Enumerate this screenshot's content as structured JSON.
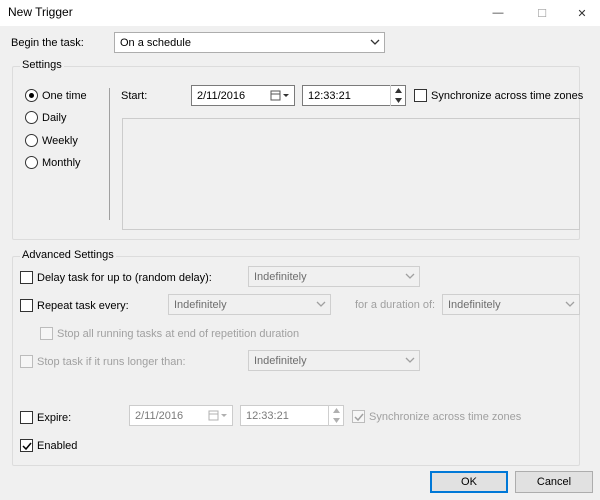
{
  "window": {
    "title": "New Trigger",
    "minimize_glyph": "—",
    "maximize_glyph": "☐",
    "close_glyph": "✕"
  },
  "begin": {
    "label": "Begin the task:",
    "value": "On a schedule"
  },
  "settings": {
    "group_title": "Settings",
    "radios": [
      {
        "label": "One time",
        "selected": true
      },
      {
        "label": "Daily",
        "selected": false
      },
      {
        "label": "Weekly",
        "selected": false
      },
      {
        "label": "Monthly",
        "selected": false
      }
    ],
    "start_label": "Start:",
    "start_date": "2/11/2016",
    "start_time": "12:33:21",
    "sync_label": "Synchronize across time zones",
    "sync_checked": false
  },
  "advanced": {
    "group_title": "Advanced Settings",
    "delay_label": "Delay task for up to (random delay):",
    "delay_value": "Indefinitely",
    "repeat_label": "Repeat task every:",
    "repeat_value": "Indefinitely",
    "duration_label": "for a duration of:",
    "duration_value": "Indefinitely",
    "stop_all_label": "Stop all running tasks at end of repetition duration",
    "stop_longer_label": "Stop task if it runs longer than:",
    "stop_longer_value": "Indefinitely",
    "expire_label": "Expire:",
    "expire_date": "2/11/2016",
    "expire_time": "12:33:21",
    "expire_sync_label": "Synchronize across time zones",
    "enabled_label": "Enabled",
    "enabled_checked": true
  },
  "buttons": {
    "ok": "OK",
    "cancel": "Cancel"
  },
  "colors": {
    "accent": "#0078d7",
    "background": "#f0f0f0"
  }
}
